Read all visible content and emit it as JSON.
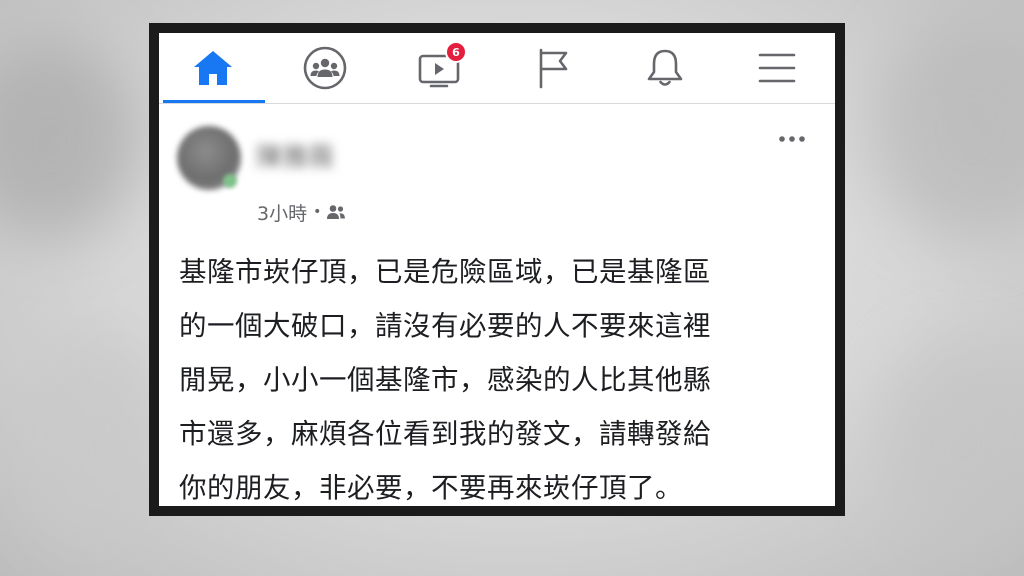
{
  "navbar": {
    "items": [
      {
        "name": "home",
        "icon": "home-icon",
        "active": true
      },
      {
        "name": "groups",
        "icon": "groups-icon"
      },
      {
        "name": "watch",
        "icon": "video-icon",
        "badge": "6"
      },
      {
        "name": "pages",
        "icon": "flag-icon"
      },
      {
        "name": "notifications",
        "icon": "bell-icon"
      },
      {
        "name": "menu",
        "icon": "menu-icon"
      }
    ],
    "accent_color": "#1877f2",
    "badge_color": "#e41e3f"
  },
  "post": {
    "author_name": "陳雅薇",
    "timestamp": "3小時",
    "separator": "•",
    "audience_icon": "friends-icon",
    "more_icon": "more-horizontal-icon",
    "text_lines": [
      "基隆市崁仔頂，已是危險區域，已是基隆區",
      "的一個大破口，請沒有必要的人不要來這裡",
      "閒晃，小小一個基隆市，感染的人比其他縣",
      "市還多，麻煩各位看到我的發文，請轉發給",
      "你的朋友，非必要，不要再來崁仔頂了。"
    ]
  }
}
